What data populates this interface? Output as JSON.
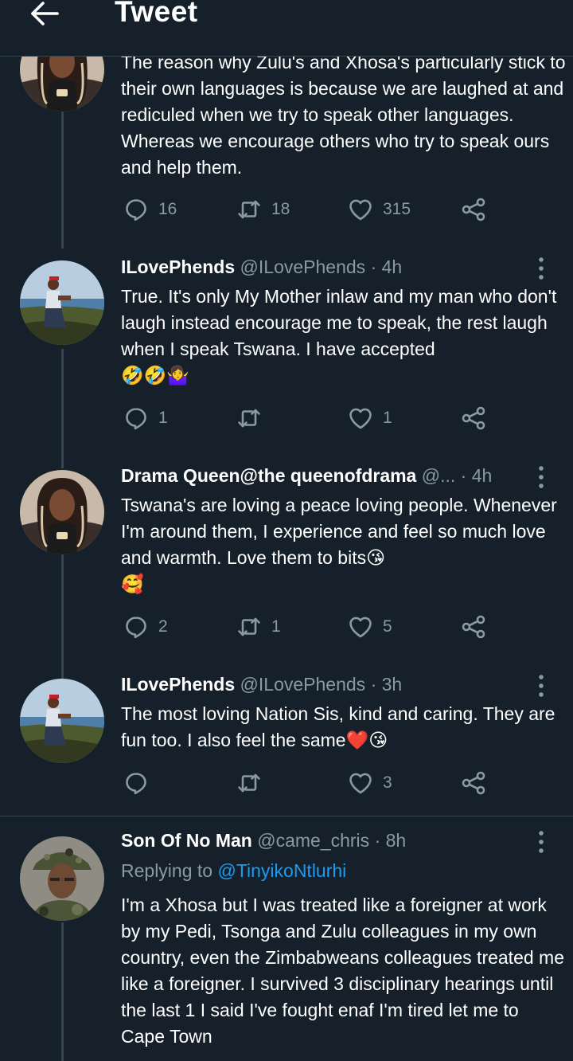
{
  "header": {
    "title": "Tweet"
  },
  "tweets": [
    {
      "text": "The reason why Zulu's and Xhosa's particularly stick to their own languages is because we are laughed at and rediculed when we try to speak other languages. Whereas we encourage others who try to speak ours and help them.",
      "replies": "16",
      "retweets": "18",
      "likes": "315"
    },
    {
      "display_name": "ILovePhends",
      "handle": "@ILovePhends",
      "time": "· 4h",
      "text": "True. It's only My Mother inlaw and my man who don't laugh instead encourage me to speak, the rest laugh when I speak Tswana. I have accepted",
      "emoji": "🤣🤣🤷‍♀️",
      "replies": "1",
      "retweets": "",
      "likes": "1"
    },
    {
      "display_name": "Drama Queen@the queenofdrama",
      "handle": "@...",
      "time": "· 4h",
      "text": "Tswana's are loving a peace loving people. Whenever I'm around them, I experience and feel so much love and warmth. Love them to bits😘",
      "emoji": "🥰",
      "replies": "2",
      "retweets": "1",
      "likes": "5"
    },
    {
      "display_name": "ILovePhends",
      "handle": "@ILovePhends",
      "time": "· 3h",
      "text": "The most loving Nation Sis, kind and caring. They are fun too. I also feel the same❤️😘",
      "replies": "",
      "retweets": "",
      "likes": "3"
    },
    {
      "display_name": "Son Of No Man",
      "handle": "@came_chris",
      "time": "· 8h",
      "replying_to_label": "Replying to",
      "replying_to_handle": "@TinyikoNtlurhi",
      "text": "I'm a Xhosa but I was treated like a foreigner at work by my Pedi, Tsonga and Zulu colleagues in my own country, even the Zimbabweans colleagues treated me like a foreigner. I survived 3 disciplinary hearings until the last 1 I said I've fought enaf I'm tired let me to Cape Town"
    }
  ],
  "colors": {
    "background": "#15202b",
    "divider": "#38444d",
    "muted": "#8b98a5",
    "link": "#1d9bf0"
  }
}
